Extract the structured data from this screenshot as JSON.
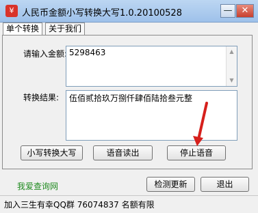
{
  "window": {
    "title": "人民币金额小写转换大写1.0.20100528",
    "minimize_glyph": "—",
    "close_glyph": "✕",
    "app_icon": "rmb-app-icon",
    "app_icon_glyph": "¥"
  },
  "tabs": [
    {
      "label": "单个转换",
      "active": true
    },
    {
      "label": "关于我们",
      "active": false
    }
  ],
  "input": {
    "label": "请输入金额:",
    "value": "5298463"
  },
  "result": {
    "label": "转换结果:",
    "value": "伍佰贰拾玖万捌仟肆佰陆拾叁元整"
  },
  "buttons": {
    "convert": "小写转换大写",
    "speak": "语音读出",
    "stop": "停止语音",
    "check_update": "检测更新",
    "exit": "退出"
  },
  "link": "我爱查询网",
  "status": "加入三生有幸QQ群 76074837 名额有限",
  "colors": {
    "arrow": "#d6201c",
    "link": "#1f8a1f"
  }
}
